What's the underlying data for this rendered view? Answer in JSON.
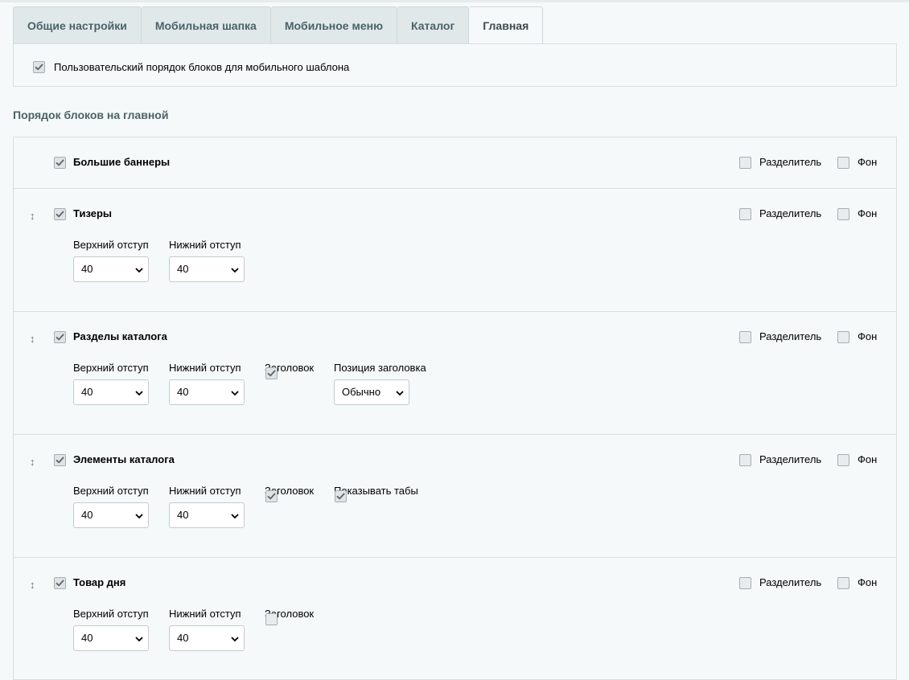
{
  "tabs": [
    {
      "label": "Общие настройки",
      "active": false
    },
    {
      "label": "Мобильная шапка",
      "active": false
    },
    {
      "label": "Мобильное меню",
      "active": false
    },
    {
      "label": "Каталог",
      "active": false
    },
    {
      "label": "Главная",
      "active": true
    }
  ],
  "mobile_order": {
    "label": "Пользовательский порядок блоков для мобильного шаблона",
    "checked": true
  },
  "section_title": "Порядок блоков на главной",
  "common": {
    "separator_label": "Разделитель",
    "background_label": "Фон",
    "drag_glyph": "↕",
    "top_margin_label": "Верхний отступ",
    "bottom_margin_label": "Нижний отступ",
    "heading_label": "Заголовок",
    "heading_position_label": "Позиция заголовка",
    "show_tabs_label": "Показывать табы"
  },
  "blocks": [
    {
      "title": "Большие баннеры",
      "enabled": true,
      "separator": false,
      "background": false
    },
    {
      "title": "Тизеры",
      "enabled": true,
      "separator": false,
      "background": false,
      "top_margin": "40",
      "bottom_margin": "40"
    },
    {
      "title": "Разделы каталога",
      "enabled": true,
      "separator": false,
      "background": false,
      "top_margin": "40",
      "bottom_margin": "40",
      "heading": true,
      "heading_position": "Обычно"
    },
    {
      "title": "Элементы каталога",
      "enabled": true,
      "separator": false,
      "background": false,
      "top_margin": "40",
      "bottom_margin": "40",
      "heading": true,
      "show_tabs": true
    },
    {
      "title": "Товар дня",
      "enabled": true,
      "separator": false,
      "background": false,
      "top_margin": "40",
      "bottom_margin": "40",
      "heading": false
    }
  ],
  "colors": {
    "page_bg": "#f5f9f9",
    "tab_bg": "#e0e8ea",
    "tab_text": "#4b6267",
    "border": "#d8e0e1"
  }
}
